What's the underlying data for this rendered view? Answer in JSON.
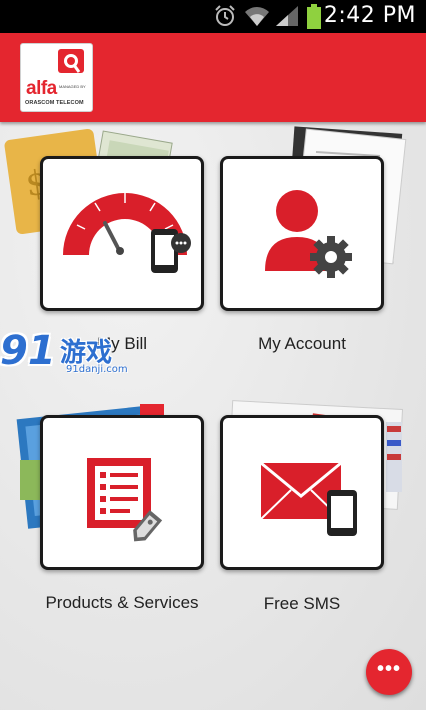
{
  "status_bar": {
    "time": "2:42 PM",
    "icons": [
      "alarm-icon",
      "wifi-icon",
      "signal-icon",
      "battery-icon"
    ]
  },
  "header": {
    "logo_brand": "alfa",
    "logo_managed": "MANAGED BY",
    "logo_orascom": "ORASCOM TELECOM",
    "accent_color": "#e4262f"
  },
  "tiles": [
    {
      "label": "My Bill",
      "icon": "gauge-phone-icon"
    },
    {
      "label": "My Account",
      "icon": "user-gear-icon"
    },
    {
      "label": "Products & Services",
      "icon": "list-tag-icon"
    },
    {
      "label": "Free SMS",
      "icon": "envelope-phone-icon"
    }
  ],
  "watermark": {
    "number": "91",
    "chinese": "游戏",
    "url": "91danji.com"
  },
  "more_button": {
    "label": "•••"
  }
}
